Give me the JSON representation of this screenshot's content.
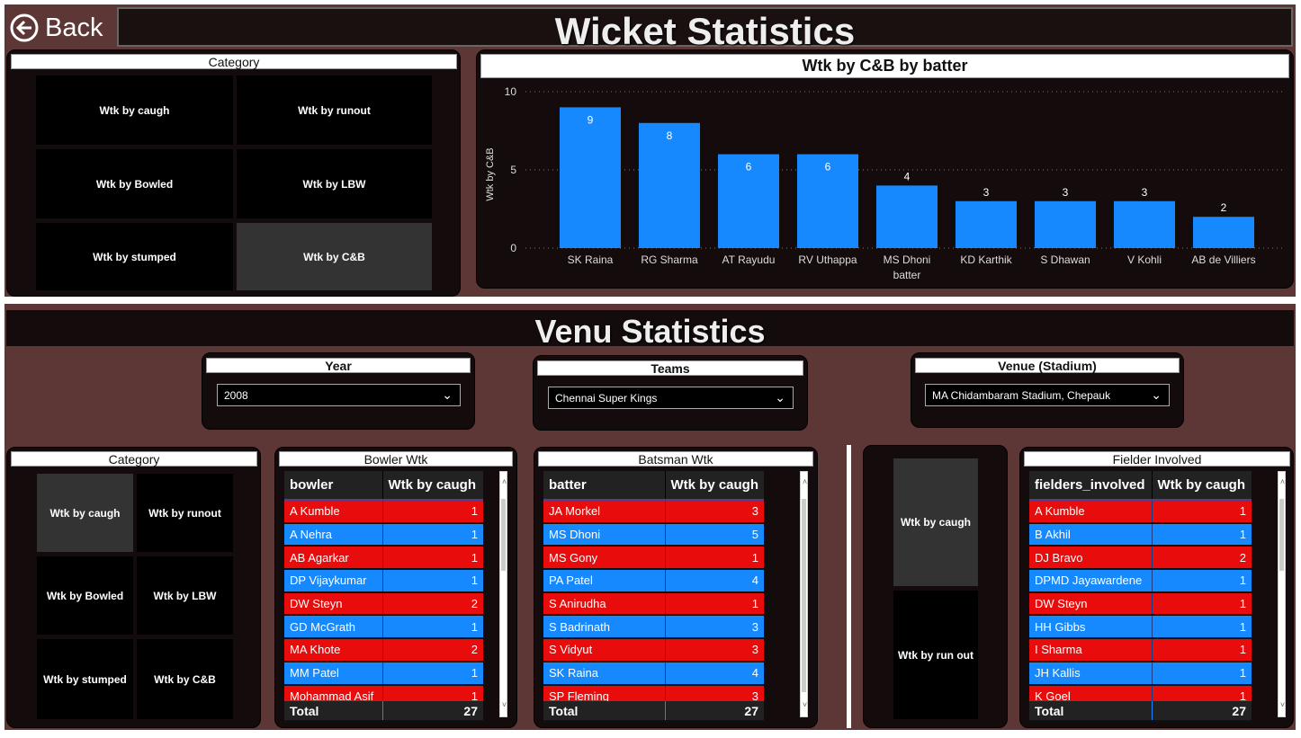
{
  "header": {
    "back_label": "Back",
    "title": "Wicket Statistics"
  },
  "top_category": {
    "title": "Category",
    "items": [
      "Wtk by caugh",
      "Wtk by runout",
      "Wtk by Bowled",
      "Wtk by LBW",
      "Wtk by stumped",
      "Wtk by C&B"
    ],
    "selected": "Wtk by C&B"
  },
  "chart_data": {
    "type": "bar",
    "title": "Wtk by C&B by batter",
    "xlabel": "batter",
    "ylabel": "Wtk by C&B",
    "ylim": [
      0,
      10
    ],
    "yticks": [
      0,
      5,
      10
    ],
    "grid": true,
    "color": "#1689ff",
    "categories": [
      "SK Raina",
      "RG Sharma",
      "AT Rayudu",
      "RV Uthappa",
      "MS Dhoni",
      "KD Karthik",
      "S Dhawan",
      "V Kohli",
      "AB de Villiers"
    ],
    "values": [
      9,
      8,
      6,
      6,
      4,
      3,
      3,
      3,
      2
    ]
  },
  "venue_section": {
    "title": "Venu Statistics"
  },
  "slicers": {
    "year": {
      "label": "Year",
      "value": "2008"
    },
    "teams": {
      "label": "Teams",
      "value": "Chennai Super Kings"
    },
    "venue": {
      "label": "Venue (Stadium)",
      "value": "MA Chidambaram Stadium, Chepauk"
    }
  },
  "bottom_category": {
    "title": "Category",
    "items": [
      "Wtk by caugh",
      "Wtk by runout",
      "Wtk by Bowled",
      "Wtk by LBW",
      "Wtk by stumped",
      "Wtk by C&B"
    ],
    "selected": "Wtk by caugh"
  },
  "fielder_slicer": {
    "items": [
      "Wtk by caugh",
      "Wtk by run out"
    ],
    "selected": "Wtk by caugh"
  },
  "colors": {
    "red_row": "#e80c0c",
    "blue_row": "#1689ff",
    "background": "#5d3636"
  },
  "tables": {
    "bowler": {
      "title": "Bowler Wtk",
      "columns": [
        "bowler",
        "Wtk by caugh"
      ],
      "rows": [
        [
          "A Kumble",
          1
        ],
        [
          "A Nehra",
          1
        ],
        [
          "AB Agarkar",
          1
        ],
        [
          "DP Vijaykumar",
          1
        ],
        [
          "DW Steyn",
          2
        ],
        [
          "GD McGrath",
          1
        ],
        [
          "MA Khote",
          2
        ],
        [
          "MM Patel",
          1
        ],
        [
          "Mohammad Asif",
          1
        ]
      ],
      "total_label": "Total",
      "total": 27
    },
    "batsman": {
      "title": "Batsman Wtk",
      "columns": [
        "batter",
        "Wtk by caugh"
      ],
      "rows": [
        [
          "JA Morkel",
          3
        ],
        [
          "MS Dhoni",
          5
        ],
        [
          "MS Gony",
          1
        ],
        [
          "PA Patel",
          4
        ],
        [
          "S Anirudha",
          1
        ],
        [
          "S Badrinath",
          3
        ],
        [
          "S Vidyut",
          3
        ],
        [
          "SK Raina",
          4
        ],
        [
          "SP Fleming",
          3
        ]
      ],
      "total_label": "Total",
      "total": 27
    },
    "fielder": {
      "title": "Fielder Involved",
      "columns": [
        "fielders_involved",
        "Wtk by caugh"
      ],
      "rows": [
        [
          "A Kumble",
          1
        ],
        [
          "B Akhil",
          1
        ],
        [
          "DJ Bravo",
          2
        ],
        [
          "DPMD Jayawardene",
          1
        ],
        [
          "DW Steyn",
          1
        ],
        [
          "HH Gibbs",
          1
        ],
        [
          "I Sharma",
          1
        ],
        [
          "JH Kallis",
          1
        ],
        [
          "K Goel",
          1
        ]
      ],
      "total_label": "Total",
      "total": 27
    }
  }
}
